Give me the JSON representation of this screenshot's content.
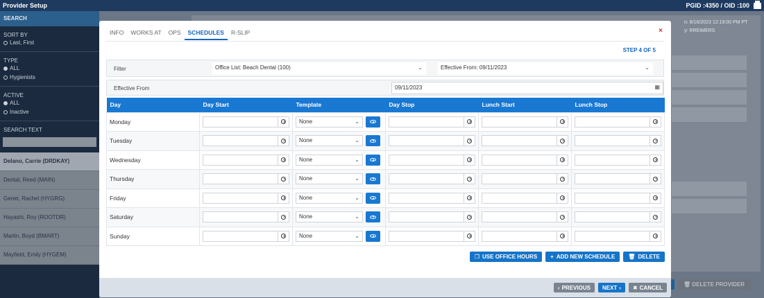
{
  "topbar": {
    "title": "Provider Setup",
    "ids": "PGID :4350  /  OID :100"
  },
  "sidebar": {
    "search_header": "SEARCH",
    "sort_by": "SORT BY",
    "sort_option": "Last, First",
    "type": "TYPE",
    "type_all": "ALL",
    "type_hygienists": "Hygienists",
    "active": "ACTIVE",
    "active_all": "ALL",
    "active_inactive": "Inactive",
    "search_text": "SEARCH TEXT",
    "providers": [
      "Delano, Carrie (DRDKAY)",
      "Dental, Reed (MAIN)",
      "Genet, Rachel (HYGRG)",
      "Hayashi, Roy (ROOTDR)",
      "Martin, Boyd (BMART)",
      "Mayfield, Emily (HYGEM)"
    ]
  },
  "background": {
    "info_line1": "n: 8/16/2023 12:19:00 PM PT",
    "info_line2": "y: RREIMERS",
    "delete_provider": "DELETE PROVIDER"
  },
  "modal": {
    "tabs": [
      "INFO",
      "WORKS AT",
      "OPS",
      "SCHEDULES",
      "R-SLIP"
    ],
    "close": "×",
    "step": "STEP 4 OF 5",
    "filter_label": "Filter",
    "office_list": "Office List: Beach Dental (100)",
    "effective_from_select": "Effective From: 09/11/2023",
    "effective_label": "Effective From",
    "effective_value": "09/11/2023",
    "columns": [
      "Day",
      "Day Start",
      "Template",
      "Day Stop",
      "Lunch Start",
      "Lunch Stop"
    ],
    "rows": [
      {
        "day": "Monday",
        "template": "None"
      },
      {
        "day": "Tuesday",
        "template": "None"
      },
      {
        "day": "Wednesday",
        "template": "None"
      },
      {
        "day": "Thursday",
        "template": "None"
      },
      {
        "day": "Friday",
        "template": "None"
      },
      {
        "day": "Saturday",
        "template": "None"
      },
      {
        "day": "Sunday",
        "template": "None"
      }
    ],
    "use_office_hours": "USE OFFICE HOURS",
    "add_new_schedule": "ADD NEW SCHEDULE",
    "delete": "DELETE",
    "previous": "PREVIOUS",
    "next": "NEXT",
    "cancel": "CANCEL"
  },
  "colors": {
    "primary": "#1878d2",
    "header_dark": "#1e3a5f",
    "close": "#d32f2f"
  },
  "icons": [
    "printer-icon",
    "close-icon",
    "chevron-down-icon",
    "calendar-icon",
    "clock-icon",
    "eye-icon",
    "copy-icon",
    "plus-icon",
    "trash-icon",
    "chevron-left-icon",
    "chevron-right-icon",
    "x-icon"
  ]
}
